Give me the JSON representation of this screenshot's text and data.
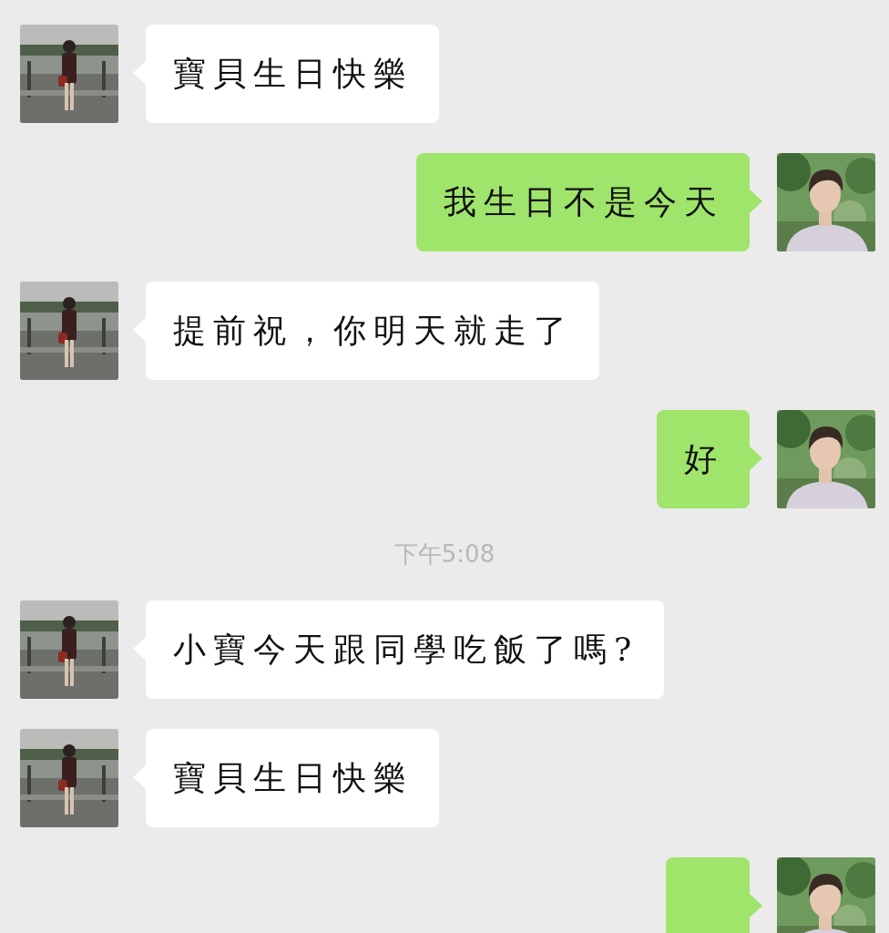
{
  "messages": [
    {
      "kind": "incoming",
      "text": "寶貝生日快樂"
    },
    {
      "kind": "outgoing",
      "text": "我生日不是今天"
    },
    {
      "kind": "incoming",
      "text": "提前祝，你明天就走了"
    },
    {
      "kind": "outgoing",
      "text": "好"
    },
    {
      "kind": "timestamp",
      "text": "下午5:08"
    },
    {
      "kind": "incoming",
      "text": "小寶今天跟同學吃飯了嗎?"
    },
    {
      "kind": "incoming",
      "text": "寶貝生日快樂"
    },
    {
      "kind": "outgoing"
    }
  ]
}
